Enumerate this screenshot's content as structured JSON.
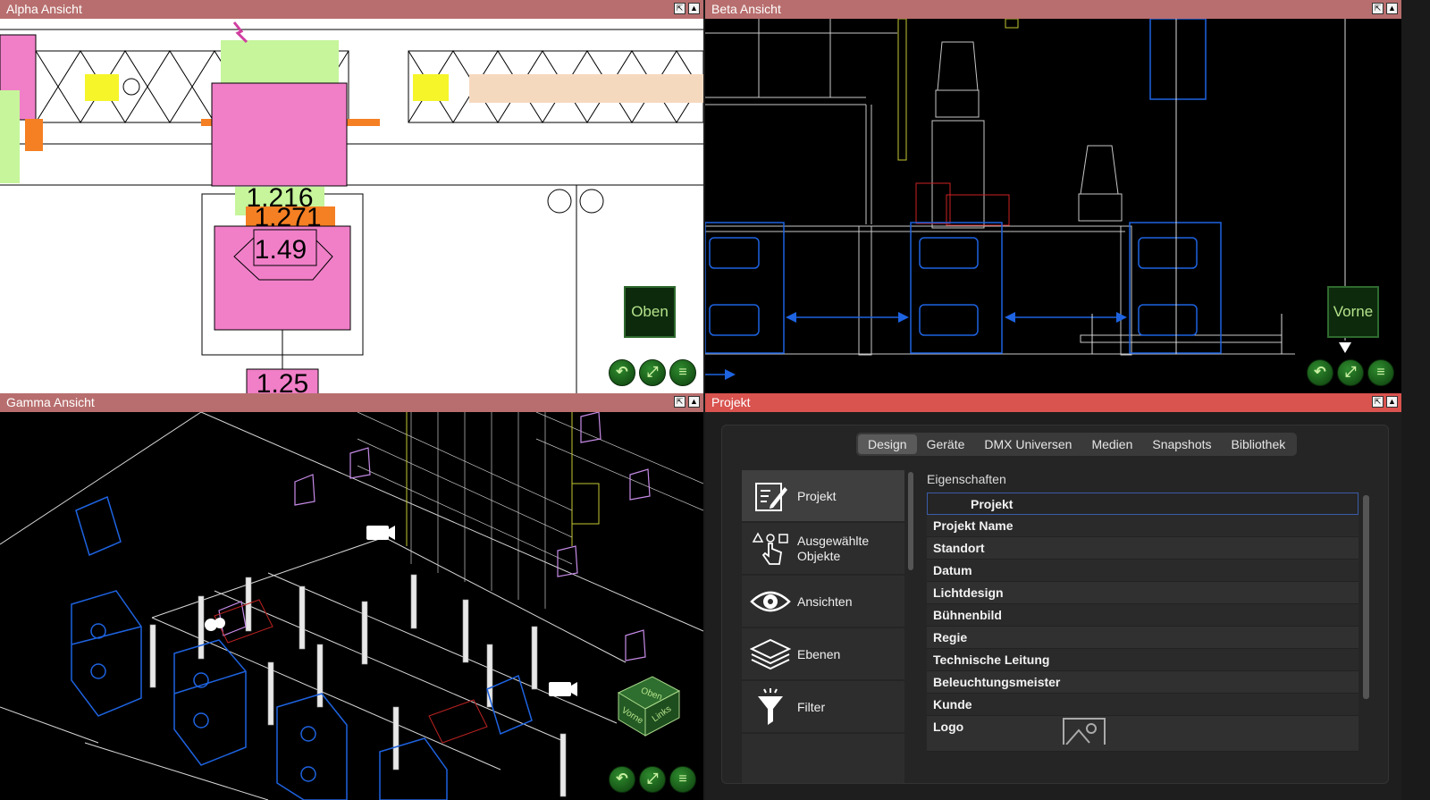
{
  "panes": {
    "alpha": {
      "title": "Alpha Ansicht",
      "orientation": "Oben",
      "labels": [
        "1.216",
        "1.271",
        "1.49",
        "1.25"
      ]
    },
    "beta": {
      "title": "Beta Ansicht",
      "orientation": "Vorne"
    },
    "gamma": {
      "title": "Gamma Ansicht",
      "cube": [
        "Oben",
        "Vorne",
        "Links"
      ]
    },
    "projekt": {
      "title": "Projekt"
    }
  },
  "window_buttons": {
    "pin": "⇱",
    "max": "▲"
  },
  "nav_buttons": {
    "undo": "↶",
    "fit": "⤢",
    "menu": "≡"
  },
  "tabs": [
    "Design",
    "Geräte",
    "DMX Universen",
    "Medien",
    "Snapshots",
    "Bibliothek"
  ],
  "selected_tab": "Design",
  "sidebar": [
    {
      "label": "Projekt",
      "icon": "project-edit-icon",
      "selected": true
    },
    {
      "label": "Ausgewählte Objekte",
      "icon": "select-pointer-icon",
      "selected": false
    },
    {
      "label": "Ansichten",
      "icon": "eye-icon",
      "selected": false
    },
    {
      "label": "Ebenen",
      "icon": "layers-icon",
      "selected": false
    },
    {
      "label": "Filter",
      "icon": "filter-funnel-icon",
      "selected": false
    }
  ],
  "properties": {
    "title": "Eigenschaften",
    "section": "Projekt",
    "rows": [
      "Projekt Name",
      "Standort",
      "Datum",
      "Lichtdesign",
      "Bühnenbild",
      "Regie",
      "Technische Leitung",
      "Beleuchtungsmeister",
      "Kunde",
      "Logo"
    ]
  }
}
